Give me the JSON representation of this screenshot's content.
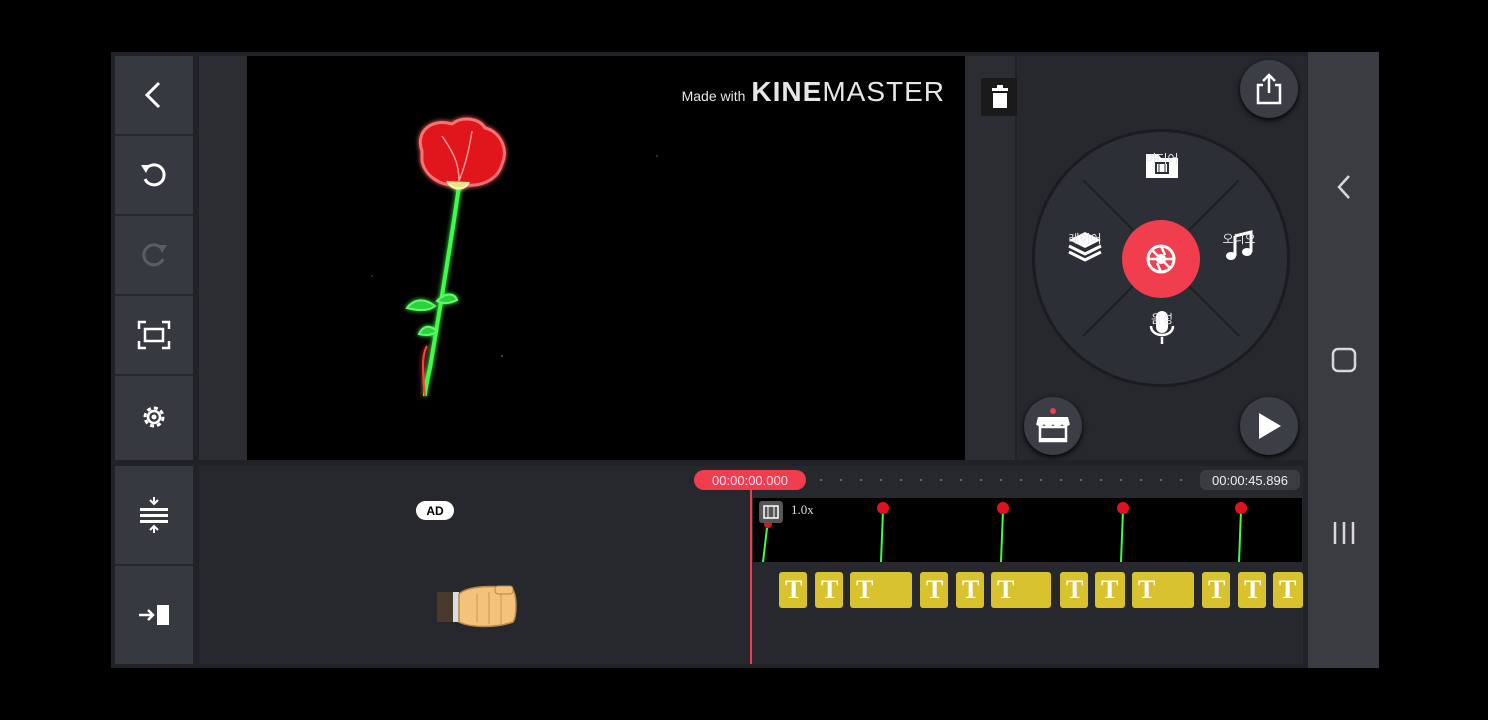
{
  "app": {
    "name": "KineMaster"
  },
  "watermark": {
    "made_with": "Made with",
    "brand_bold": "KINE",
    "brand_light": "MASTER"
  },
  "left_toolbar": {
    "items": [
      {
        "name": "back-icon"
      },
      {
        "name": "undo-icon"
      },
      {
        "name": "redo-icon"
      },
      {
        "name": "screen-capture-icon"
      },
      {
        "name": "settings-gear-icon"
      }
    ]
  },
  "timeline_tools": {
    "items": [
      {
        "name": "timeline-expand-icon"
      },
      {
        "name": "jump-to-end-icon"
      }
    ]
  },
  "media_wheel": {
    "media_label": "미디어",
    "layer_label": "레이어",
    "audio_label": "오디오",
    "voice_label": "음성"
  },
  "timeline": {
    "current_time": "00:00:00.000",
    "total_time": "00:00:45.896",
    "clip_speed": "1.0x",
    "text_layer_glyph": "T",
    "ad_badge": "AD"
  },
  "colors": {
    "accent": "#f03e4f",
    "text_layer": "#d8c22e",
    "panel": "#36393f"
  },
  "nav": {
    "items": [
      "back-nav-icon",
      "home-nav-icon",
      "recents-nav-icon"
    ]
  }
}
